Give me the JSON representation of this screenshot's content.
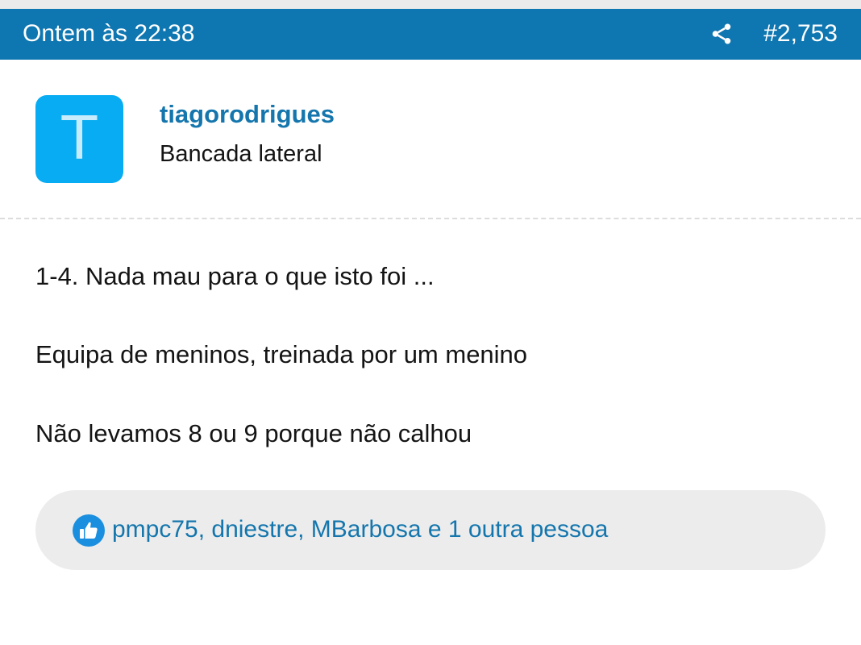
{
  "post": {
    "date": "Ontem às 22:38",
    "number": "#2,753",
    "share_icon": "share-icon"
  },
  "author": {
    "avatar_letter": "T",
    "username": "tiagorodrigues",
    "title": "Bancada lateral"
  },
  "content": {
    "lines": [
      "1-4. Nada mau para o que isto foi ...",
      "Equipa de meninos, treinada por um menino",
      "Não levamos 8 ou 9 porque não calhou"
    ]
  },
  "reactions": {
    "icon": "thumbs-up-icon",
    "text": "pmpc75, dniestre, MBarbosa e 1 outra pessoa"
  },
  "colors": {
    "header_bg": "#0e76b0",
    "avatar_bg": "#08acf2",
    "link": "#1476ad",
    "reaction_bar_bg": "#ececec"
  }
}
